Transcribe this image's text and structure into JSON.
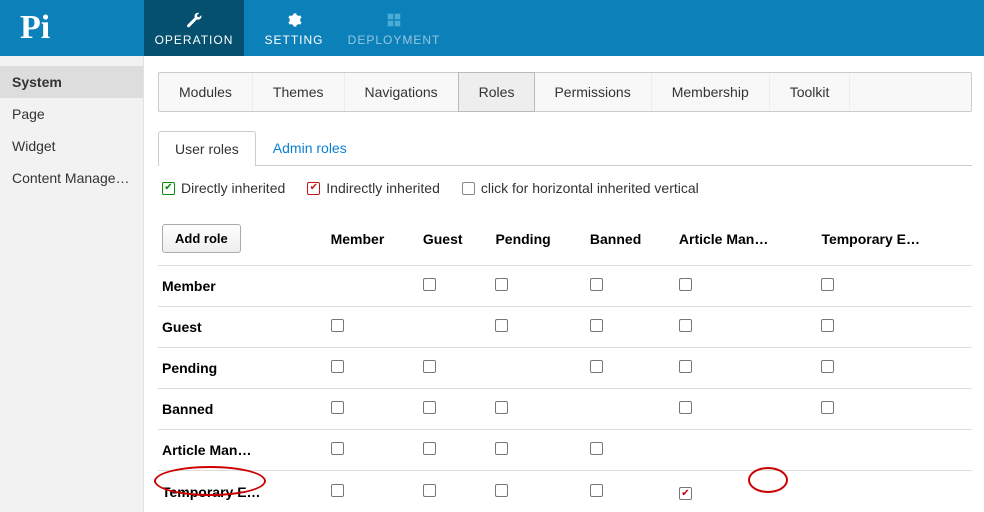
{
  "logo": "Pi",
  "topnav": [
    {
      "label": "OPERATION",
      "icon": "wrench",
      "active": true,
      "dim": false
    },
    {
      "label": "SETTING",
      "icon": "gear",
      "active": false,
      "dim": false
    },
    {
      "label": "DEPLOYMENT",
      "icon": "grid",
      "active": false,
      "dim": true
    }
  ],
  "sidebar": [
    {
      "label": "System",
      "active": true
    },
    {
      "label": "Page",
      "active": false
    },
    {
      "label": "Widget",
      "active": false
    },
    {
      "label": "Content Manage…",
      "active": false
    }
  ],
  "tabs": [
    {
      "label": "Modules"
    },
    {
      "label": "Themes"
    },
    {
      "label": "Navigations"
    },
    {
      "label": "Roles",
      "active": true
    },
    {
      "label": "Permissions"
    },
    {
      "label": "Membership"
    },
    {
      "label": "Toolkit"
    }
  ],
  "subtabs": [
    {
      "label": "User roles",
      "active": true
    },
    {
      "label": "Admin roles",
      "active": false
    }
  ],
  "legend": {
    "direct": "Directly inherited",
    "indirect": "Indirectly inherited",
    "click": "click for horizontal inherited vertical"
  },
  "addrole_label": "Add role",
  "columns": [
    "Member",
    "Guest",
    "Pending",
    "Banned",
    "Article Man…",
    "Temporary E…"
  ],
  "rows": [
    {
      "label": "Member",
      "cells": [
        null,
        false,
        false,
        false,
        false,
        false
      ]
    },
    {
      "label": "Guest",
      "cells": [
        false,
        null,
        false,
        false,
        false,
        false
      ]
    },
    {
      "label": "Pending",
      "cells": [
        false,
        false,
        null,
        false,
        false,
        false
      ]
    },
    {
      "label": "Banned",
      "cells": [
        false,
        false,
        false,
        null,
        false,
        false
      ]
    },
    {
      "label": "Article Man…",
      "cells": [
        false,
        false,
        false,
        false,
        null,
        null
      ]
    },
    {
      "label": "Temporary E…",
      "cells": [
        false,
        false,
        false,
        false,
        true,
        null
      ]
    }
  ]
}
